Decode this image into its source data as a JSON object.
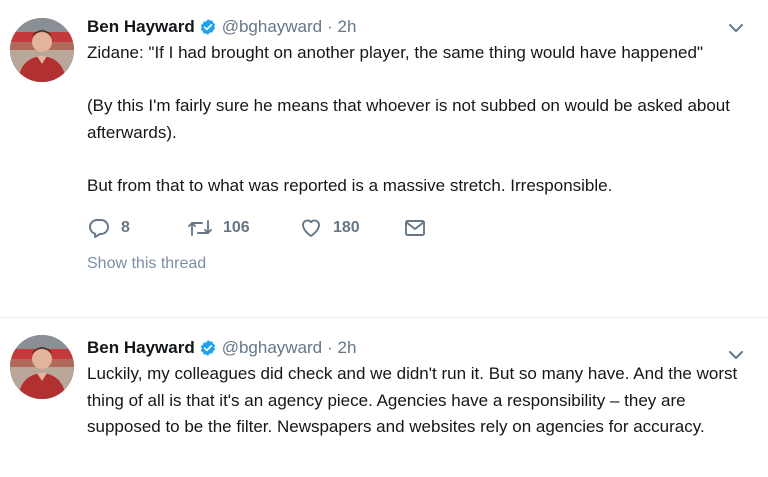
{
  "tweets": [
    {
      "author": {
        "name": "Ben Hayward",
        "handle": "@bghayward",
        "time": "· 2h"
      },
      "paragraphs": [
        "Zidane: \"If I had brought on another player, the same thing would have happened\"",
        "(By this I'm fairly sure he means that whoever is not subbed on would be asked about afterwards).",
        "But from that to what was reported is a massive stretch. Irresponsible."
      ],
      "counts": {
        "replies": "8",
        "retweets": "106",
        "likes": "180"
      },
      "show_thread": "Show this thread"
    },
    {
      "author": {
        "name": "Ben Hayward",
        "handle": "@bghayward",
        "time": "· 2h"
      },
      "paragraphs": [
        "Luckily, my colleagues did check and we didn't run it. But so many have. And the worst thing of all is that it's an agency piece. Agencies have a responsibility – they are supposed to be the filter. Newspapers and websites rely on agencies for accuracy."
      ]
    }
  ],
  "icons": {
    "verified": "verified-badge-icon",
    "caret": "chevron-down-icon",
    "reply": "reply-icon",
    "retweet": "retweet-icon",
    "like": "heart-icon",
    "message": "direct-message-icon"
  },
  "colors": {
    "verified": "#1da1f2",
    "muted": "#657786",
    "thread_link": "#7a8fa6",
    "divider": "#e6ecf0"
  }
}
